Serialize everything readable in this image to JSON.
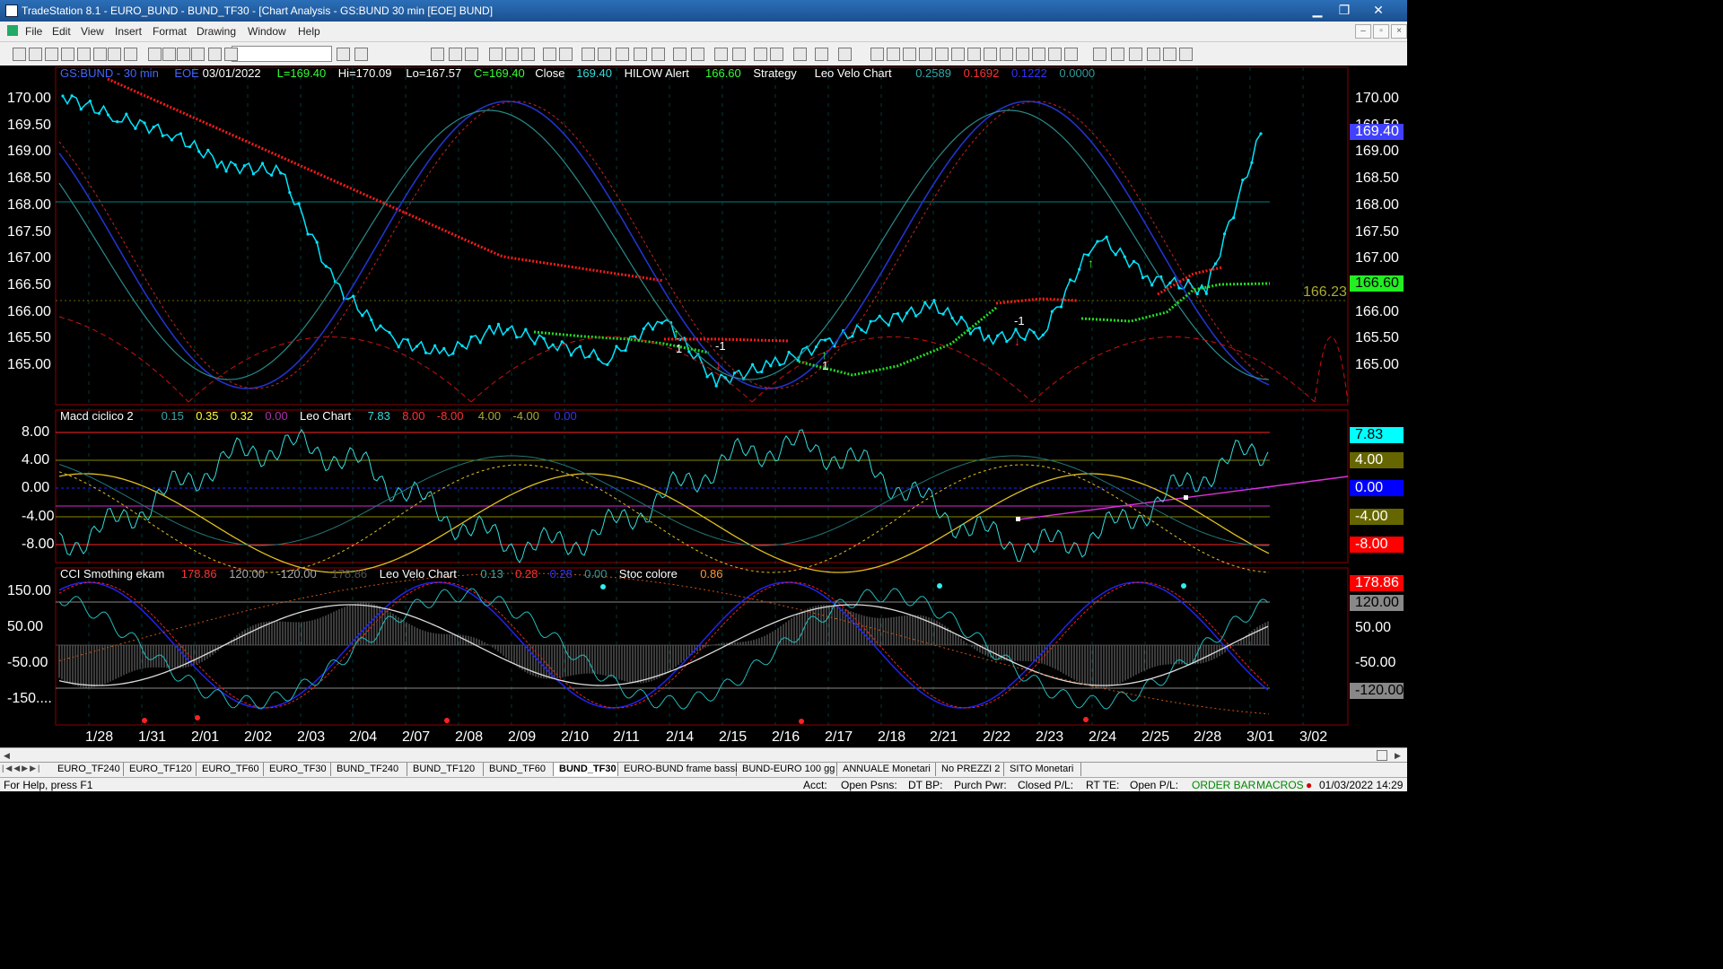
{
  "window": {
    "title": "TradeStation 8.1 - EURO_BUND - BUND_TF30 - [Chart Analysis - GS:BUND  30 min  [EOE] BUND]"
  },
  "menu": [
    "File",
    "Edit",
    "View",
    "Insert",
    "Format",
    "Drawing",
    "Window",
    "Help"
  ],
  "panel1": {
    "header": [
      {
        "t": "GS:BUND - 30 min",
        "c": "#4466ff"
      },
      {
        "t": "EOE",
        "c": "#4466ff"
      },
      {
        "t": "03/01/2022",
        "c": "#fff"
      },
      {
        "t": "L=169.40",
        "c": "#33ff33"
      },
      {
        "t": "Hi=170.09",
        "c": "#fff"
      },
      {
        "t": "Lo=167.57",
        "c": "#fff"
      },
      {
        "t": "C=169.40",
        "c": "#33ff33"
      },
      {
        "t": "Close",
        "c": "#fff"
      },
      {
        "t": "169.40",
        "c": "#33dddd"
      },
      {
        "t": "HILOW Alert",
        "c": "#fff"
      },
      {
        "t": "166.60",
        "c": "#33ff33"
      },
      {
        "t": "Strategy",
        "c": "#fff"
      },
      {
        "t": "Leo Velo Chart",
        "c": "#fff"
      },
      {
        "t": "0.2589",
        "c": "#33aaaa"
      },
      {
        "t": "0.1692",
        "c": "#ff3333"
      },
      {
        "t": "0.1222",
        "c": "#3333ff"
      },
      {
        "t": "0.0000",
        "c": "#339999"
      }
    ],
    "yticks": [
      "170.00",
      "169.50",
      "169.00",
      "168.50",
      "168.00",
      "167.50",
      "167.00",
      "166.50",
      "166.00",
      "165.50",
      "165.00"
    ],
    "right_ticks": [
      "170.00",
      "169.50",
      "169.00",
      "168.50",
      "168.00",
      "167.50",
      "167.00",
      "166.50",
      "166.00",
      "165.50",
      "165.00"
    ],
    "tag_last": "169.40",
    "tag_strategy": "166.60",
    "level_label": "166.23",
    "marker_1": "1",
    "marker_neg1": "-1"
  },
  "panel2": {
    "header": [
      {
        "t": "Macd ciclico 2",
        "c": "#fff"
      },
      {
        "t": "0.15",
        "c": "#33aaaa"
      },
      {
        "t": "0.35",
        "c": "#ffff33"
      },
      {
        "t": "0.32",
        "c": "#ffff33"
      },
      {
        "t": "0.00",
        "c": "#aa33aa"
      },
      {
        "t": "Leo Chart",
        "c": "#fff"
      },
      {
        "t": "7.83",
        "c": "#33dddd"
      },
      {
        "t": "8.00",
        "c": "#ff3333"
      },
      {
        "t": "-8.00",
        "c": "#ff3333"
      },
      {
        "t": "4.00",
        "c": "#aaaa33"
      },
      {
        "t": "-4.00",
        "c": "#aaaa33"
      },
      {
        "t": "0.00",
        "c": "#3333ff"
      }
    ],
    "yticks": [
      "8.00",
      "4.00",
      "0.00",
      "-4.00",
      "-8.00"
    ],
    "right_tags": [
      {
        "t": "7.83",
        "bg": "#00ffff",
        "fg": "#000"
      },
      {
        "t": "4.00",
        "bg": "#666600",
        "fg": "#fff"
      },
      {
        "t": "0.00",
        "bg": "#0000ff",
        "fg": "#fff"
      },
      {
        "t": "-4.00",
        "bg": "#666600",
        "fg": "#fff"
      },
      {
        "t": "-8.00",
        "bg": "#ff0000",
        "fg": "#fff"
      }
    ]
  },
  "panel3": {
    "header": [
      {
        "t": "CCI Smothing ekam",
        "c": "#fff"
      },
      {
        "t": "178.86",
        "c": "#ff3333"
      },
      {
        "t": "120.00",
        "c": "#aaaaaa"
      },
      {
        "t": "-120.00",
        "c": "#aaaaaa"
      },
      {
        "t": "178.86",
        "c": "#555555"
      },
      {
        "t": "Leo Velo Chart",
        "c": "#fff"
      },
      {
        "t": "0.13",
        "c": "#33aaaa"
      },
      {
        "t": "0.28",
        "c": "#ff3333"
      },
      {
        "t": "0.28",
        "c": "#3333ff"
      },
      {
        "t": "0.00",
        "c": "#339999"
      },
      {
        "t": "Stoc colore",
        "c": "#fff"
      },
      {
        "t": "0.86",
        "c": "#ff9933"
      }
    ],
    "yticks": [
      "150.00",
      "50.00",
      "-50.00",
      "-150...."
    ],
    "right_tags": [
      {
        "t": "178.86",
        "bg": "#ff0000",
        "fg": "#fff"
      },
      {
        "t": "120.00",
        "bg": "#888888",
        "fg": "#000"
      },
      {
        "t": "50.00",
        "bg": "#000",
        "fg": "#fff"
      },
      {
        "t": "-50.00",
        "bg": "#000",
        "fg": "#fff"
      },
      {
        "t": "-120.00",
        "bg": "#888888",
        "fg": "#000"
      }
    ]
  },
  "dates": [
    "1/28",
    "1/31",
    "2/01",
    "2/02",
    "2/03",
    "2/04",
    "2/07",
    "2/08",
    "2/09",
    "2/10",
    "2/11",
    "2/14",
    "2/15",
    "2/16",
    "2/17",
    "2/18",
    "2/21",
    "2/22",
    "2/23",
    "2/24",
    "2/25",
    "2/28",
    "3/01",
    "3/02"
  ],
  "tabs": [
    "EURO_TF240",
    "EURO_TF120",
    "EURO_TF60",
    "EURO_TF30",
    "BUND_TF240",
    "BUND_TF120",
    "BUND_TF60",
    "BUND_TF30",
    "EURO-BUND frame bassi",
    "BUND-EURO 100 gg",
    "ANNUALE Monetari",
    "No PREZZI 2",
    "SITO Monetari"
  ],
  "active_tab": "BUND_TF30",
  "status": {
    "help": "For Help, press F1",
    "acct": "Acct:",
    "open_psns": "Open Psns:",
    "dt_bp": "DT BP:",
    "purch_pwr": "Purch Pwr:",
    "closed_pl": "Closed P/L:",
    "rt_te": "RT TE:",
    "open_pl": "Open P/L:",
    "order_bar": "ORDER BAR",
    "macros": "MACROS",
    "datetime": "01/03/2022 14:29"
  },
  "chart_data": [
    {
      "type": "line",
      "title": "GS:BUND - 30 min",
      "ylim": [
        164.5,
        170.3
      ],
      "categories": [
        "1/28",
        "1/31",
        "2/01",
        "2/02",
        "2/03",
        "2/04",
        "2/07",
        "2/08",
        "2/09",
        "2/10",
        "2/11",
        "2/14",
        "2/15",
        "2/16",
        "2/17",
        "2/18",
        "2/21",
        "2/22",
        "2/23",
        "2/24",
        "2/25",
        "2/28",
        "3/01"
      ],
      "series": [
        {
          "name": "Close",
          "values": [
            170.1,
            169.7,
            169.4,
            168.8,
            168.7,
            166.6,
            165.6,
            165.3,
            165.8,
            165.5,
            165.2,
            166.0,
            164.8,
            165.1,
            165.5,
            165.9,
            166.2,
            165.6,
            165.7,
            167.5,
            166.7,
            166.5,
            169.4
          ]
        }
      ]
    }
  ]
}
